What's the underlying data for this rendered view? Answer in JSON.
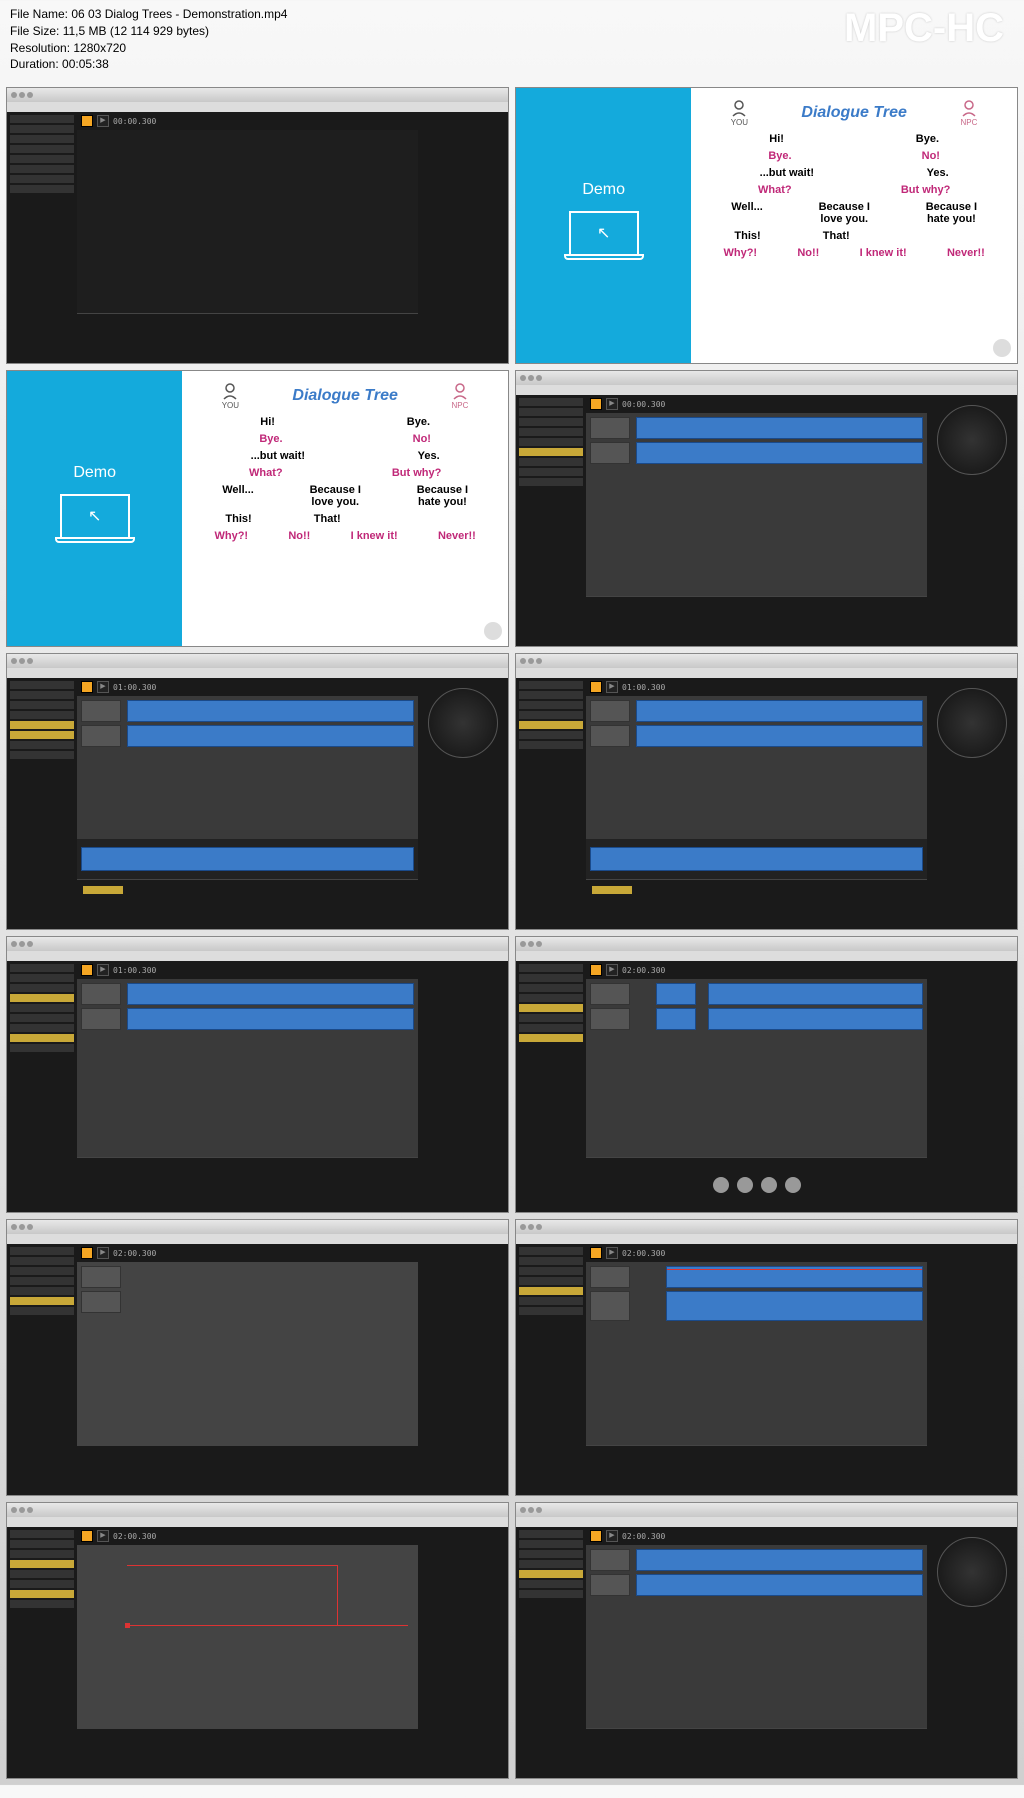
{
  "header": {
    "file_name_label": "File Name: ",
    "file_name": "06 03 Dialog Trees - Demonstration.mp4",
    "file_size_label": "File Size: ",
    "file_size": "11,5 MB (12 114 929 bytes)",
    "resolution_label": "Resolution: ",
    "resolution": "1280x720",
    "duration_label": "Duration: ",
    "duration": "00:05:38",
    "app_logo": "MPC-HC"
  },
  "daw": {
    "time": "00:00.300",
    "time2": "01:00.300",
    "time3": "02:00.300"
  },
  "slide": {
    "demo_label": "Demo",
    "tree_title": "Dialogue Tree",
    "you_label": "YOU",
    "npc_label": "NPC",
    "nodes": {
      "hi": "Hi!",
      "bye2": "Bye.",
      "bye": "Bye.",
      "no": "No!",
      "butwait": "...but wait!",
      "yes": "Yes.",
      "what": "What?",
      "butwhy": "But why?",
      "well": "Well...",
      "because_love": "Because I\nlove you.",
      "because_hate": "Because I\nhate you!",
      "this": "This!",
      "that": "That!",
      "why": "Why?!",
      "no2": "No!!",
      "knewit": "I knew it!",
      "never": "Never!!"
    }
  }
}
